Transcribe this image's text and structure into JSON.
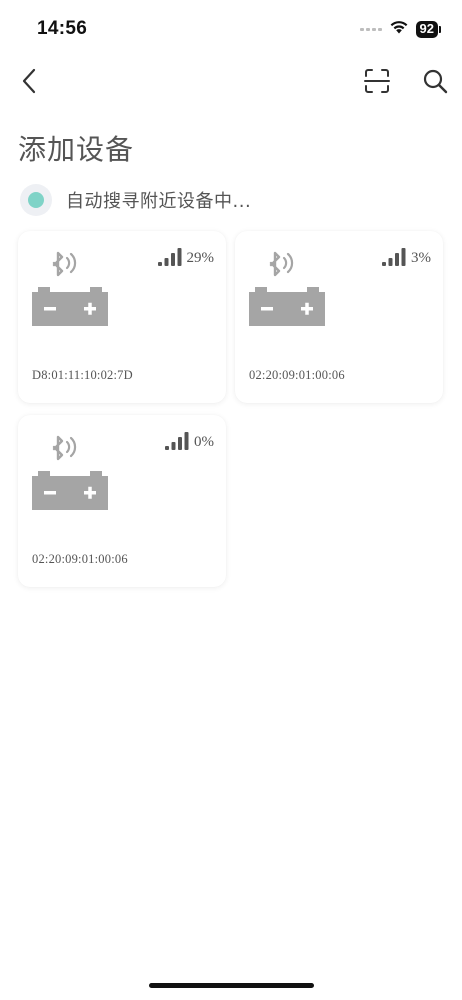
{
  "status_bar": {
    "time": "14:56",
    "battery_level": "92",
    "icons": [
      "cellular-dots-icon",
      "wifi-icon",
      "battery-icon"
    ]
  },
  "nav": {
    "icons": [
      "back-chevron-icon",
      "scan-icon",
      "search-icon"
    ]
  },
  "page": {
    "title": "添加设备",
    "search_status": "自动搜寻附近设备中...",
    "accent_color": "#7fd3c7"
  },
  "devices": [
    {
      "signal_percent": "29%",
      "mac": "D8:01:11:10:02:7D",
      "signal_level_bars": 4
    },
    {
      "signal_percent": "3%",
      "mac": "02:20:09:01:00:06",
      "signal_level_bars": 4
    },
    {
      "signal_percent": "0%",
      "mac": "02:20:09:01:00:06",
      "signal_level_bars": 4
    }
  ],
  "device_icon": "bluetooth-battery-icon"
}
